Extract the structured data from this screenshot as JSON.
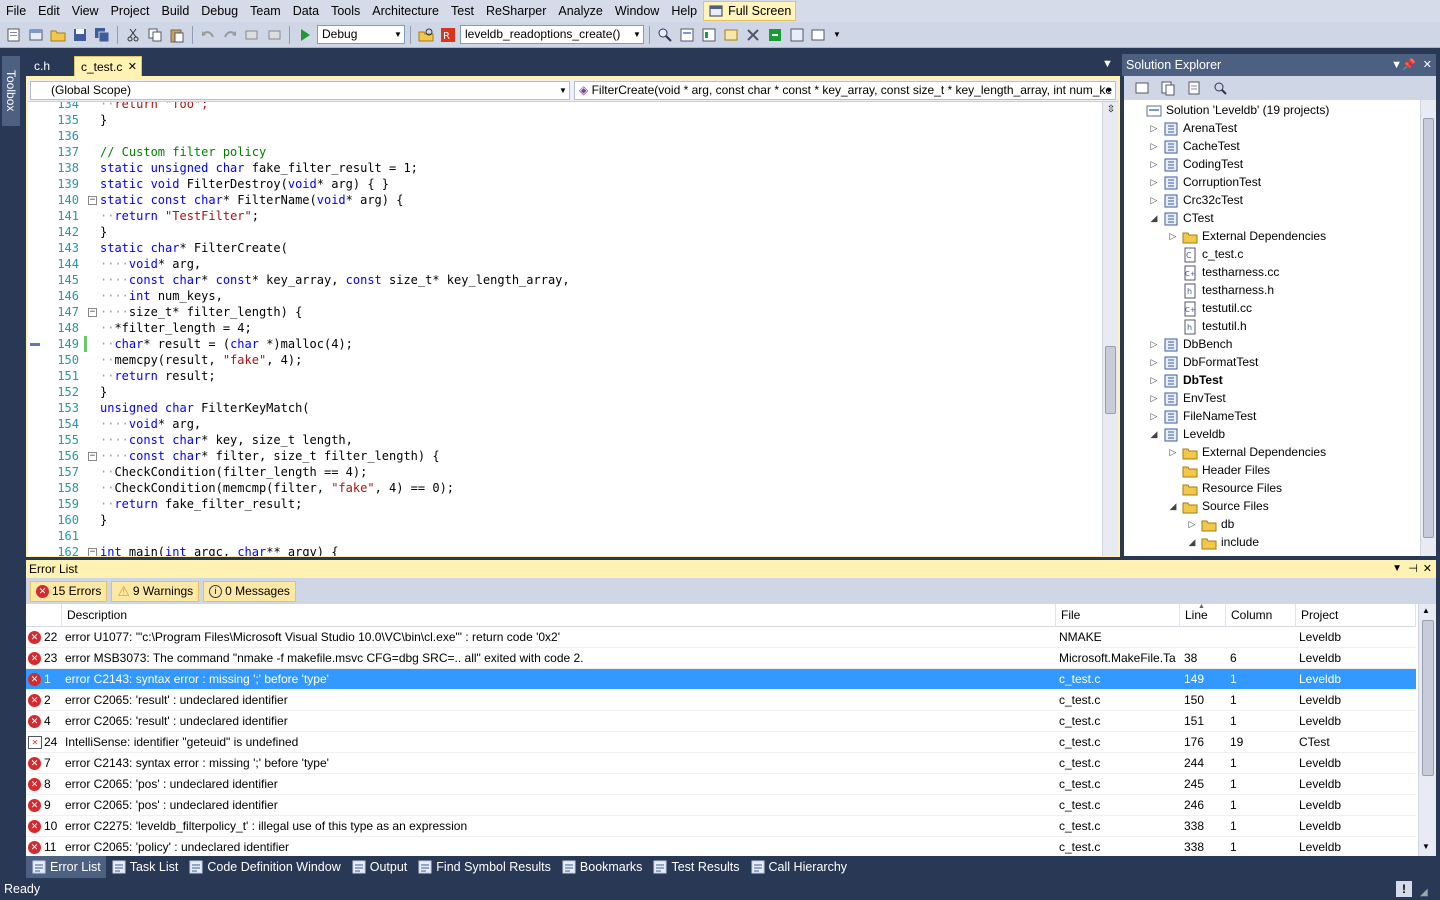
{
  "menu": [
    "File",
    "Edit",
    "View",
    "Project",
    "Build",
    "Debug",
    "Team",
    "Data",
    "Tools",
    "Architecture",
    "Test",
    "ReSharper",
    "Analyze",
    "Window",
    "Help"
  ],
  "full_screen_label": "Full Screen",
  "toolbar": {
    "config": "Debug",
    "find_combo": "leveldb_readoptions_create()"
  },
  "toolbox_label": "Toolbox",
  "doc_tabs": [
    "c.h",
    "c_test.c"
  ],
  "scope": {
    "left": "(Global Scope)",
    "right": "FilterCreate(void * arg, const char * const * key_array, const size_t * key_length_array, int num_ke"
  },
  "code_lines": [
    {
      "n": "134",
      "segs": [
        [
          "ws",
          "··"
        ],
        [
          "st",
          "return \"foo\";"
        ]
      ]
    },
    {
      "n": "135",
      "segs": [
        [
          "",
          "}"
        ]
      ]
    },
    {
      "n": "136",
      "segs": [
        [
          "",
          ""
        ]
      ]
    },
    {
      "n": "137",
      "segs": [
        [
          "cm",
          "// Custom filter policy"
        ]
      ]
    },
    {
      "n": "138",
      "segs": [
        [
          "kw",
          "static unsigned char"
        ],
        [
          "",
          " fake_filter_result = 1;"
        ]
      ]
    },
    {
      "n": "139",
      "segs": [
        [
          "kw",
          "static void"
        ],
        [
          "",
          " FilterDestroy("
        ],
        [
          "kw",
          "void"
        ],
        [
          "",
          "* arg) { }"
        ]
      ]
    },
    {
      "n": "140",
      "segs": [
        [
          "kw",
          "static const char"
        ],
        [
          "",
          "* FilterName("
        ],
        [
          "kw",
          "void"
        ],
        [
          "",
          "* arg) {"
        ]
      ]
    },
    {
      "n": "141",
      "segs": [
        [
          "ws",
          "··"
        ],
        [
          "kw",
          "return"
        ],
        [
          "",
          " "
        ],
        [
          "st",
          "\"TestFilter\""
        ],
        [
          "",
          ";"
        ]
      ]
    },
    {
      "n": "142",
      "segs": [
        [
          "",
          "}"
        ]
      ]
    },
    {
      "n": "143",
      "segs": [
        [
          "kw",
          "static char"
        ],
        [
          "",
          "* FilterCreate("
        ]
      ]
    },
    {
      "n": "144",
      "segs": [
        [
          "ws",
          "····"
        ],
        [
          "kw",
          "void"
        ],
        [
          "",
          "* arg,"
        ]
      ]
    },
    {
      "n": "145",
      "segs": [
        [
          "ws",
          "····"
        ],
        [
          "kw",
          "const char"
        ],
        [
          "",
          "* "
        ],
        [
          "kw",
          "const"
        ],
        [
          "",
          "* key_array, "
        ],
        [
          "kw",
          "const"
        ],
        [
          "",
          " size_t* key_length_array,"
        ]
      ]
    },
    {
      "n": "146",
      "segs": [
        [
          "ws",
          "····"
        ],
        [
          "kw",
          "int"
        ],
        [
          "",
          " num_keys,"
        ]
      ]
    },
    {
      "n": "147",
      "segs": [
        [
          "ws",
          "····"
        ],
        [
          "",
          "size_t* filter_length) {"
        ]
      ]
    },
    {
      "n": "148",
      "segs": [
        [
          "ws",
          "··"
        ],
        [
          "",
          "*filter_length = 4;"
        ]
      ]
    },
    {
      "n": "149",
      "segs": [
        [
          "ws",
          "··"
        ],
        [
          "kw",
          "char"
        ],
        [
          "",
          "* result = ("
        ],
        [
          "kw",
          "char"
        ],
        [
          "",
          " *)malloc(4);"
        ]
      ]
    },
    {
      "n": "150",
      "segs": [
        [
          "ws",
          "··"
        ],
        [
          "",
          "memcpy(result, "
        ],
        [
          "st",
          "\"fake\""
        ],
        [
          "",
          ", 4);"
        ]
      ]
    },
    {
      "n": "151",
      "segs": [
        [
          "ws",
          "··"
        ],
        [
          "kw",
          "return"
        ],
        [
          "",
          " result;"
        ]
      ]
    },
    {
      "n": "152",
      "segs": [
        [
          "",
          "}"
        ]
      ]
    },
    {
      "n": "153",
      "segs": [
        [
          "kw",
          "unsigned char"
        ],
        [
          "",
          " FilterKeyMatch("
        ]
      ]
    },
    {
      "n": "154",
      "segs": [
        [
          "ws",
          "····"
        ],
        [
          "kw",
          "void"
        ],
        [
          "",
          "* arg,"
        ]
      ]
    },
    {
      "n": "155",
      "segs": [
        [
          "ws",
          "····"
        ],
        [
          "kw",
          "const char"
        ],
        [
          "",
          "* key, size_t length,"
        ]
      ]
    },
    {
      "n": "156",
      "segs": [
        [
          "ws",
          "····"
        ],
        [
          "kw",
          "const char"
        ],
        [
          "",
          "* filter, size_t filter_length) {"
        ]
      ]
    },
    {
      "n": "157",
      "segs": [
        [
          "ws",
          "··"
        ],
        [
          "",
          "CheckCondition(filter_length == 4);"
        ]
      ]
    },
    {
      "n": "158",
      "segs": [
        [
          "ws",
          "··"
        ],
        [
          "",
          "CheckCondition(memcmp(filter, "
        ],
        [
          "st",
          "\"fake\""
        ],
        [
          "",
          ", 4) == 0);"
        ]
      ]
    },
    {
      "n": "159",
      "segs": [
        [
          "ws",
          "··"
        ],
        [
          "kw",
          "return"
        ],
        [
          "",
          " fake_filter_result;"
        ]
      ]
    },
    {
      "n": "160",
      "segs": [
        [
          "",
          "}"
        ]
      ]
    },
    {
      "n": "161",
      "segs": [
        [
          "",
          ""
        ]
      ]
    },
    {
      "n": "162",
      "segs": [
        [
          "kw",
          "int"
        ],
        [
          "",
          " main("
        ],
        [
          "kw",
          "int"
        ],
        [
          "",
          " argc, "
        ],
        [
          "kw",
          "char"
        ],
        [
          "",
          "** argv) {"
        ]
      ]
    }
  ],
  "solution_explorer": {
    "title": "Solution Explorer",
    "items": [
      {
        "label": "Solution 'Leveldb' (19 projects)",
        "icon": "solution-icon",
        "exp": ""
      },
      {
        "label": "ArenaTest",
        "icon": "project-icon",
        "exp": "▷"
      },
      {
        "label": "CacheTest",
        "icon": "project-icon",
        "exp": "▷"
      },
      {
        "label": "CodingTest",
        "icon": "project-icon",
        "exp": "▷"
      },
      {
        "label": "CorruptionTest",
        "icon": "project-icon",
        "exp": "▷"
      },
      {
        "label": "Crc32cTest",
        "icon": "project-icon",
        "exp": "▷"
      },
      {
        "label": "CTest",
        "icon": "project-icon",
        "exp": "◢"
      },
      {
        "label": "External Dependencies",
        "icon": "folder-icon",
        "exp": "▷"
      },
      {
        "label": "c_test.c",
        "icon": "c-file-icon",
        "exp": ""
      },
      {
        "label": "testharness.cc",
        "icon": "cpp-file-icon",
        "exp": ""
      },
      {
        "label": "testharness.h",
        "icon": "h-file-icon",
        "exp": ""
      },
      {
        "label": "testutil.cc",
        "icon": "cpp-file-icon",
        "exp": ""
      },
      {
        "label": "testutil.h",
        "icon": "h-file-icon",
        "exp": ""
      },
      {
        "label": "DbBench",
        "icon": "project-icon",
        "exp": "▷"
      },
      {
        "label": "DbFormatTest",
        "icon": "project-icon",
        "exp": "▷"
      },
      {
        "label": "DbTest",
        "icon": "project-icon",
        "exp": "▷"
      },
      {
        "label": "EnvTest",
        "icon": "project-icon",
        "exp": "▷"
      },
      {
        "label": "FileNameTest",
        "icon": "project-icon",
        "exp": "▷"
      },
      {
        "label": "Leveldb",
        "icon": "project-icon",
        "exp": "◢"
      },
      {
        "label": "External Dependencies",
        "icon": "folder-icon",
        "exp": "▷"
      },
      {
        "label": "Header Files",
        "icon": "folder-icon",
        "exp": ""
      },
      {
        "label": "Resource Files",
        "icon": "folder-icon",
        "exp": ""
      },
      {
        "label": "Source Files",
        "icon": "folder-icon",
        "exp": "◢"
      },
      {
        "label": "db",
        "icon": "folder-icon",
        "exp": "▷"
      },
      {
        "label": "include",
        "icon": "folder-icon",
        "exp": "◢"
      }
    ]
  },
  "error_list": {
    "title": "Error List",
    "filters": {
      "errors": "15 Errors",
      "warnings": "9 Warnings",
      "messages": "0 Messages"
    },
    "columns": [
      "Description",
      "File",
      "Line",
      "Column",
      "Project"
    ],
    "rows": [
      {
        "n": "22",
        "desc": "error U1077: '\"c:\\Program Files\\Microsoft Visual Studio 10.0\\VC\\bin\\cl.exe\"' : return code '0x2'",
        "file": "NMAKE",
        "line": "",
        "col": "",
        "proj": "Leveldb",
        "kind": "error"
      },
      {
        "n": "23",
        "desc": "error MSB3073: The command \"nmake -f makefile.msvc CFG=dbg SRC=.. all\" exited with code 2.",
        "file": "Microsoft.MakeFile.Ta",
        "line": "38",
        "col": "6",
        "proj": "Leveldb",
        "kind": "error"
      },
      {
        "n": "1",
        "desc": "error C2143: syntax error : missing ';' before 'type'",
        "file": "c_test.c",
        "line": "149",
        "col": "1",
        "proj": "Leveldb",
        "kind": "error"
      },
      {
        "n": "2",
        "desc": "error C2065: 'result' : undeclared identifier",
        "file": "c_test.c",
        "line": "150",
        "col": "1",
        "proj": "Leveldb",
        "kind": "error"
      },
      {
        "n": "4",
        "desc": "error C2065: 'result' : undeclared identifier",
        "file": "c_test.c",
        "line": "151",
        "col": "1",
        "proj": "Leveldb",
        "kind": "error"
      },
      {
        "n": "24",
        "desc": "IntelliSense: identifier \"geteuid\" is undefined",
        "file": "c_test.c",
        "line": "176",
        "col": "19",
        "proj": "CTest",
        "kind": "intellisense"
      },
      {
        "n": "7",
        "desc": "error C2143: syntax error : missing ';' before 'type'",
        "file": "c_test.c",
        "line": "244",
        "col": "1",
        "proj": "Leveldb",
        "kind": "error"
      },
      {
        "n": "8",
        "desc": "error C2065: 'pos' : undeclared identifier",
        "file": "c_test.c",
        "line": "245",
        "col": "1",
        "proj": "Leveldb",
        "kind": "error"
      },
      {
        "n": "9",
        "desc": "error C2065: 'pos' : undeclared identifier",
        "file": "c_test.c",
        "line": "246",
        "col": "1",
        "proj": "Leveldb",
        "kind": "error"
      },
      {
        "n": "10",
        "desc": "error C2275: 'leveldb_filterpolicy_t' : illegal use of this type as an expression",
        "file": "c_test.c",
        "line": "338",
        "col": "1",
        "proj": "Leveldb",
        "kind": "error"
      },
      {
        "n": "11",
        "desc": "error C2065: 'policy' : undeclared identifier",
        "file": "c_test.c",
        "line": "338",
        "col": "1",
        "proj": "Leveldb",
        "kind": "error"
      }
    ]
  },
  "bottom_tabs": [
    "Error List",
    "Task List",
    "Code Definition Window",
    "Output",
    "Find Symbol Results",
    "Bookmarks",
    "Test Results",
    "Call Hierarchy"
  ],
  "status": "Ready",
  "colors": {
    "accent": "#293955",
    "selection": "#3399ff",
    "tab_active": "#fff2b3",
    "keyword": "#0000ff",
    "string": "#a31515",
    "comment": "#008000"
  }
}
